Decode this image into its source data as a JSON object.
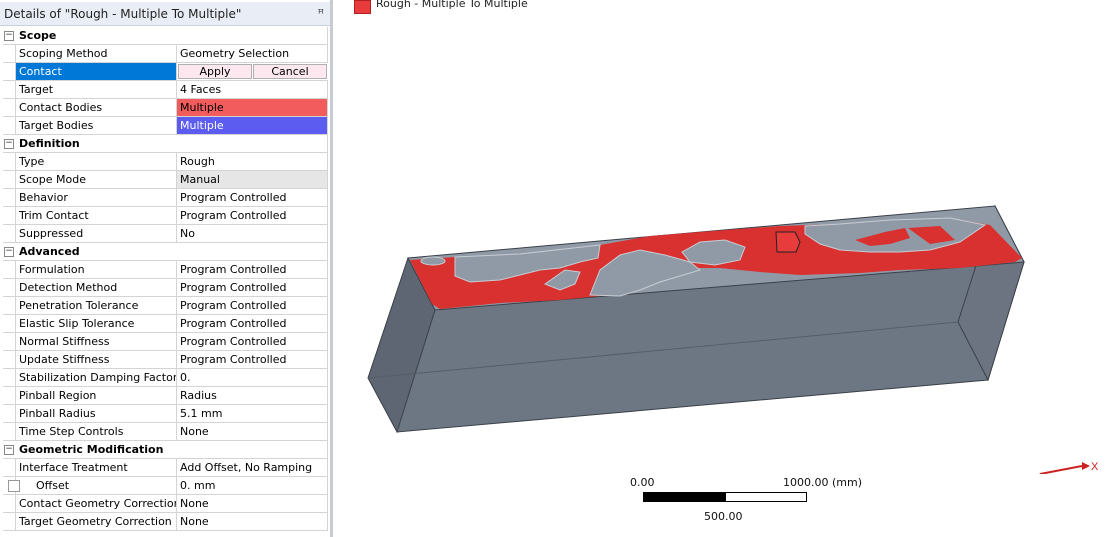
{
  "panel": {
    "title": "Details of \"Rough - Multiple To Multiple\"",
    "pin_icon": "pushpin-icon",
    "rows": [
      {
        "kind": "group",
        "label": "Scope"
      },
      {
        "label": "Scoping Method",
        "value": "Geometry Selection"
      },
      {
        "label": "Contact",
        "apply": "Apply",
        "cancel": "Cancel",
        "selected": true
      },
      {
        "label": "Target",
        "value": "4 Faces"
      },
      {
        "label": "Contact Bodies",
        "value": "Multiple",
        "style": "red"
      },
      {
        "label": "Target Bodies",
        "value": "Multiple",
        "style": "blue"
      },
      {
        "kind": "group",
        "label": "Definition"
      },
      {
        "label": "Type",
        "value": "Rough"
      },
      {
        "label": "Scope Mode",
        "value": "Manual",
        "style": "grey"
      },
      {
        "label": "Behavior",
        "value": "Program Controlled"
      },
      {
        "label": "Trim Contact",
        "value": "Program Controlled"
      },
      {
        "label": "Suppressed",
        "value": "No"
      },
      {
        "kind": "group",
        "label": "Advanced"
      },
      {
        "label": "Formulation",
        "value": "Program Controlled"
      },
      {
        "label": "Detection Method",
        "value": "Program Controlled"
      },
      {
        "label": "Penetration Tolerance",
        "value": "Program Controlled"
      },
      {
        "label": "Elastic Slip Tolerance",
        "value": "Program Controlled"
      },
      {
        "label": "Normal Stiffness",
        "value": "Program Controlled"
      },
      {
        "label": "Update Stiffness",
        "value": "Program Controlled"
      },
      {
        "label": "Stabilization Damping Factor",
        "value": "0."
      },
      {
        "label": "Pinball Region",
        "value": "Radius"
      },
      {
        "label": "Pinball Radius",
        "value": "5.1 mm"
      },
      {
        "label": "Time Step Controls",
        "value": "None"
      },
      {
        "kind": "group",
        "label": "Geometric Modification"
      },
      {
        "label": "Interface Treatment",
        "value": "Add Offset, No Ramping"
      },
      {
        "label": "Offset",
        "value": "0. mm",
        "checkbox": true
      },
      {
        "label": "Contact Geometry Correction",
        "value": "None"
      },
      {
        "label": "Target Geometry Correction",
        "value": "None"
      }
    ]
  },
  "viewport": {
    "legend_label": "Rough - Multiple To Multiple",
    "legend_color": "#e83c3c",
    "body_color": "#6e7884",
    "top_face_color": "#8f9aa8",
    "contact_color": "#d93030",
    "scale_left": "0.00",
    "scale_right": "1000.00 (mm)",
    "scale_mid": "500.00",
    "triad_x_label": "X"
  }
}
